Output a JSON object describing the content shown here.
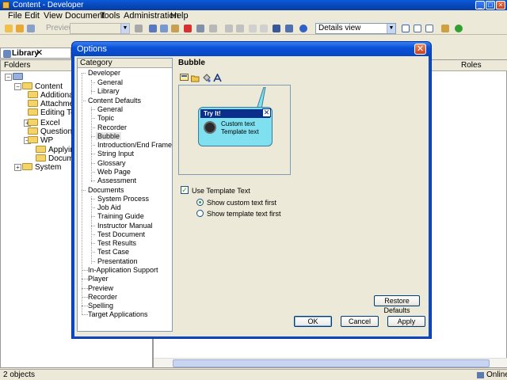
{
  "window": {
    "title": "Content - Developer"
  },
  "menu": [
    "File",
    "Edit",
    "View",
    "Document",
    "Tools",
    "Administration",
    "Help"
  ],
  "toolbar": {
    "preview_label": "Preview",
    "view_combo": "Details view"
  },
  "library": {
    "tab_label": "Library",
    "folders_header": "Folders",
    "roles_header": "Roles",
    "tree": [
      "Content",
      "Additional Top",
      "Attachments",
      "Editing Techni",
      "Excel",
      "Questions and",
      "WP",
      "Applying",
      "Document",
      "System"
    ]
  },
  "status": {
    "left": "2 objects",
    "right": "Online"
  },
  "dialog": {
    "title": "Options",
    "category_header": "Category",
    "categories": [
      "Developer",
      "General",
      "Library",
      "Content Defaults",
      "General",
      "Topic",
      "Recorder",
      "Bubble",
      "Introduction/End Frame",
      "String Input",
      "Glossary",
      "Web Page",
      "Assessment",
      "Documents",
      "System Process",
      "Job Aid",
      "Training Guide",
      "Instructor Manual",
      "Test Document",
      "Test Results",
      "Test Case",
      "Presentation",
      "In-Application Support",
      "Player",
      "Preview",
      "Recorder",
      "Spelling",
      "Target Applications"
    ],
    "section_title": "Bubble",
    "bubble": {
      "header": "Try It!",
      "close_glyph": "✕",
      "line1": "Custom text",
      "line2": "Template text"
    },
    "use_template_text": {
      "label": "Use Template Text",
      "checked": true
    },
    "radio_custom_first": "Show custom text first",
    "radio_template_first": "Show template text first",
    "restore_defaults": "Restore Defaults",
    "ok": "OK",
    "cancel": "Cancel",
    "apply": "Apply"
  }
}
